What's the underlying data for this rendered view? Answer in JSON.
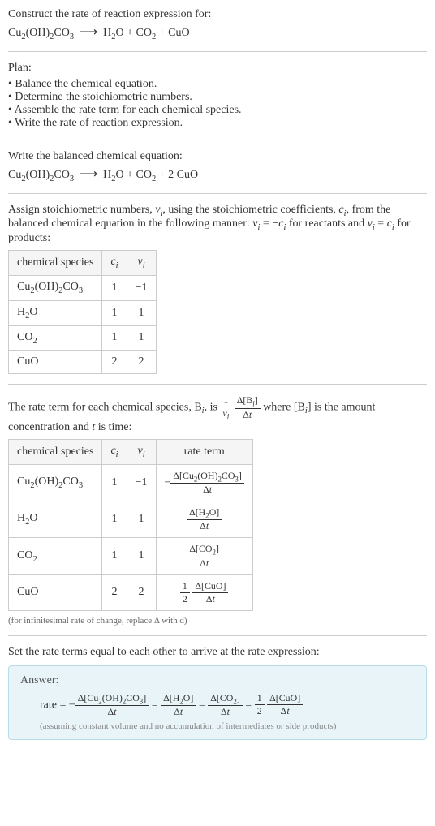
{
  "intro": {
    "prompt": "Construct the rate of reaction expression for:"
  },
  "plan": {
    "heading": "Plan:",
    "items": [
      "Balance the chemical equation.",
      "Determine the stoichiometric numbers.",
      "Assemble the rate term for each chemical species.",
      "Write the rate of reaction expression."
    ]
  },
  "balanced": {
    "heading": "Write the balanced chemical equation:"
  },
  "stoich": {
    "text_a": "Assign stoichiometric numbers, ",
    "text_b": ", using the stoichiometric coefficients, ",
    "text_c": ", from the balanced chemical equation in the following manner: ",
    "text_d": " for reactants and ",
    "text_e": " for products:"
  },
  "table1": {
    "headers": [
      "chemical species",
      "cᵢ",
      "νᵢ"
    ],
    "rows": [
      {
        "c": "1",
        "v": "−1"
      },
      {
        "c": "1",
        "v": "1"
      },
      {
        "c": "1",
        "v": "1"
      },
      {
        "c": "2",
        "v": "2"
      }
    ]
  },
  "rateterm": {
    "text_a": "The rate term for each chemical species, B",
    "text_b": ", is ",
    "text_c": " where [B",
    "text_d": "] is the amount concentration and ",
    "text_e": " is time:"
  },
  "table2": {
    "headers": [
      "chemical species",
      "cᵢ",
      "νᵢ",
      "rate term"
    ],
    "rows": [
      {
        "c": "1",
        "v": "−1"
      },
      {
        "c": "1",
        "v": "1"
      },
      {
        "c": "1",
        "v": "1"
      },
      {
        "c": "2",
        "v": "2"
      }
    ]
  },
  "note1": "(for infinitesimal rate of change, replace Δ with d)",
  "final_heading": "Set the rate terms equal to each other to arrive at the rate expression:",
  "answer": {
    "label": "Answer:",
    "note": "(assuming constant volume and no accumulation of intermediates or side products)"
  },
  "species": {
    "cu": "Cu₂(OH)₂CO₃",
    "h2o": "H₂O",
    "co2": "CO₂",
    "cuo": "CuO"
  },
  "syms": {
    "nu_i": "νᵢ",
    "c_i": "cᵢ",
    "i": "i",
    "t": "t",
    "delta": "Δ",
    "dt": "Δt",
    "half": "1",
    "two": "2",
    "rate": "rate = "
  }
}
